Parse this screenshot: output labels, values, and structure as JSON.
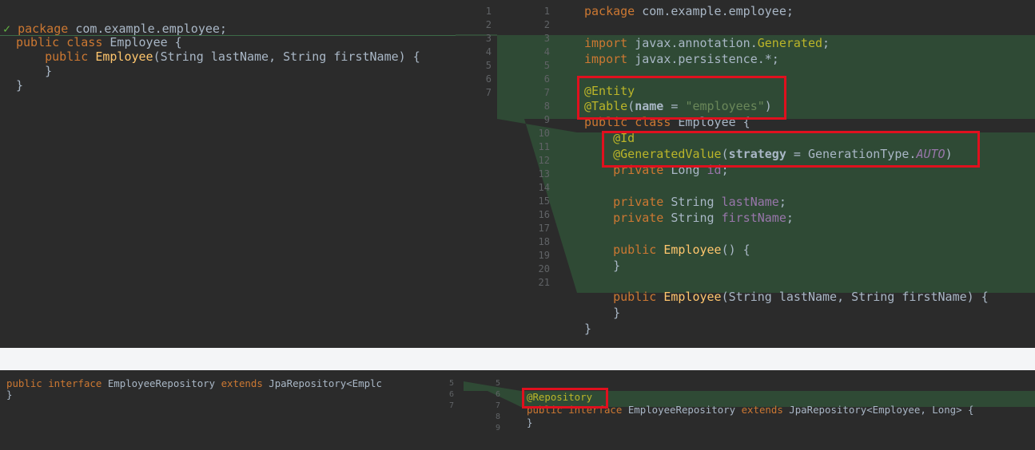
{
  "top": {
    "left_lines": [
      "package com.example.employee;",
      "",
      "public class Employee {",
      "    public Employee(String lastName, String firstName) {",
      "    }",
      "}"
    ],
    "gutter_left_numbers": [
      "1",
      "2",
      "3",
      "4",
      "5",
      "6",
      "7"
    ],
    "gutter_right_numbers": [
      "1",
      "2",
      "3",
      "4",
      "5",
      "6",
      "7",
      "8",
      "9",
      "10",
      "11",
      "12",
      "13",
      "14",
      "15",
      "16",
      "17",
      "18",
      "19",
      "20",
      "21"
    ],
    "right_lines": [
      "package com.example.employee;",
      "",
      "import javax.annotation.Generated;",
      "import javax.persistence.*;",
      "",
      "@Entity",
      "@Table(name = \"employees\")",
      "public class Employee {",
      "    @Id",
      "    @GeneratedValue(strategy = GenerationType.AUTO)",
      "    private Long id;",
      "",
      "    private String lastName;",
      "    private String firstName;",
      "",
      "    public Employee() {",
      "    }",
      "",
      "    public Employee(String lastName, String firstName) {",
      "    }",
      "}"
    ]
  },
  "bottom": {
    "left_lines": [
      "public interface EmployeeRepository extends JpaRepository<Emplc",
      "}"
    ],
    "gutter_left_numbers": [
      "5",
      "6",
      "7"
    ],
    "gutter_right_numbers": [
      "5",
      "6",
      "7",
      "8",
      "9"
    ],
    "right_lines": [
      "@Repository",
      "public interface EmployeeRepository extends JpaRepository<Employee, Long> {",
      "}"
    ]
  },
  "icons": {
    "check": "check-icon"
  },
  "colors": {
    "background": "#2b2b2b",
    "added_highlight": "#2f4a35",
    "annotation_box": "#e0101e"
  }
}
